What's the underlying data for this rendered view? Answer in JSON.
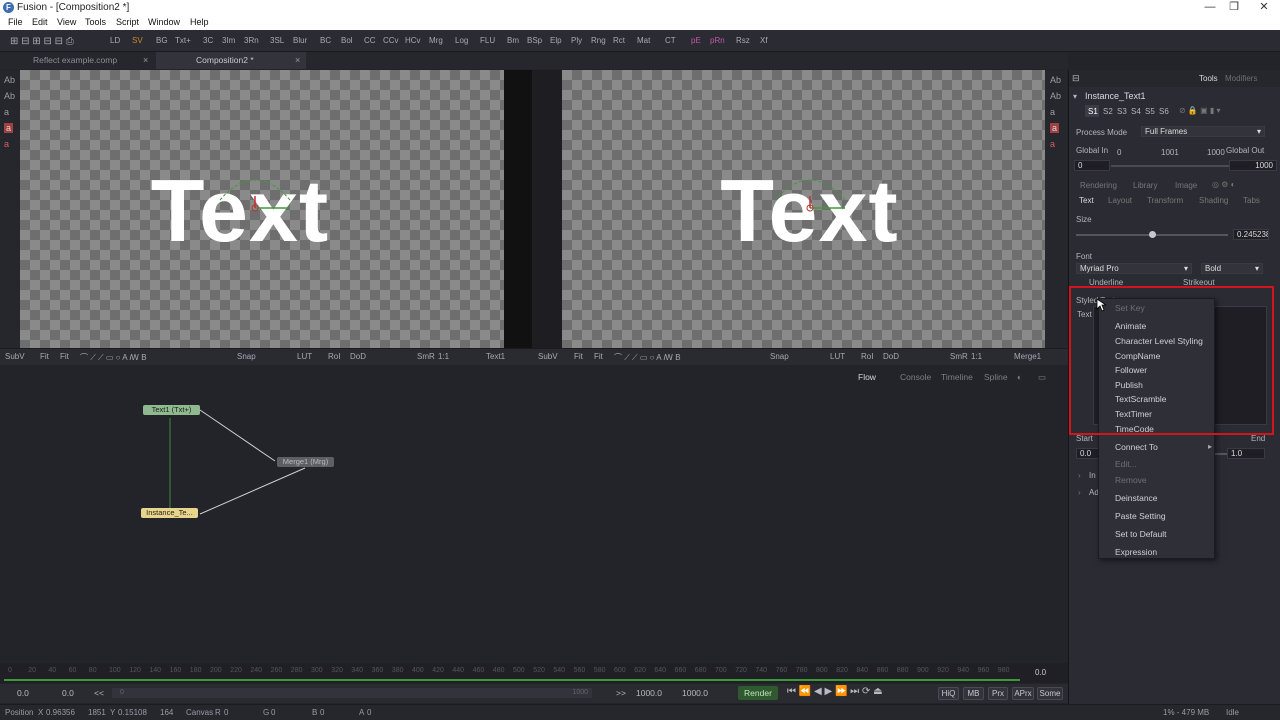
{
  "window": {
    "title": "Fusion - [Composition2 *]",
    "minimize": "—",
    "restore": "❐",
    "close": "✕"
  },
  "menu": [
    "File",
    "Edit",
    "View",
    "Tools",
    "Script",
    "Window",
    "Help"
  ],
  "toolbar": [
    "LD",
    "SV",
    "BG",
    "Txt+",
    "3C",
    "3Im",
    "3Rn",
    "3SL",
    "Blur",
    "BC",
    "Bol",
    "CC",
    "CCv",
    "HCv",
    "Mrg",
    "Log",
    "FLU",
    "Bm",
    "BSp",
    "Elp",
    "Ply",
    "Rng",
    "Rct",
    "Mat",
    "CT",
    "pE",
    "pRn",
    "Rsz",
    "Xf"
  ],
  "tabs": [
    {
      "label": "Reflect example.comp"
    },
    {
      "label": "Composition2 *"
    }
  ],
  "left_strip": [
    "Ab",
    "Ab",
    "a",
    "a",
    "a"
  ],
  "right_strip": [
    "Ab",
    "Ab",
    "a",
    "a",
    "a"
  ],
  "viewer1": {
    "text": "Text",
    "bar": [
      "SubV",
      "Fit",
      "Fit",
      "Snap",
      "LUT",
      "RoI",
      "DoD",
      "SmR",
      "1:1",
      "Text1"
    ]
  },
  "viewer2": {
    "text": "Text",
    "bar": [
      "SubV",
      "Fit",
      "Fit",
      "Snap",
      "LUT",
      "RoI",
      "DoD",
      "SmR",
      "1:1",
      "Merge1"
    ]
  },
  "flow_tabs": [
    "Flow",
    "Console",
    "Timeline",
    "Spline"
  ],
  "nodes": {
    "text1": "Text1 (Txt+)",
    "merge1": "Merge1 (Mrg)",
    "instance": "Instance_Te..."
  },
  "timeline": {
    "ticks": [
      "0",
      "20",
      "40",
      "60",
      "80",
      "100",
      "120",
      "140",
      "160",
      "180",
      "200",
      "220",
      "240",
      "260",
      "280",
      "300",
      "320",
      "340",
      "360",
      "380",
      "400",
      "420",
      "440",
      "460",
      "480",
      "500",
      "520",
      "540",
      "560",
      "580",
      "600",
      "620",
      "640",
      "660",
      "680",
      "700",
      "720",
      "740",
      "760",
      "780",
      "800",
      "820",
      "840",
      "860",
      "880",
      "900",
      "920",
      "940",
      "960",
      "980"
    ],
    "end": "0.0"
  },
  "transport": {
    "start": "0.0",
    "current": "0.0",
    "range_start": "0",
    "range_end": "1000",
    "end1": "1000.0",
    "end2": "1000.0",
    "render": "Render",
    "buttons": [
      "HiQ",
      "MB",
      "Prx",
      "APrx",
      "Some"
    ]
  },
  "status": {
    "position_label": "Position",
    "x_label": "X",
    "x": "0.96356",
    "x_px": "1851",
    "y_label": "Y",
    "y": "0.15108",
    "y_px": "164",
    "canvas_label": "Canvas",
    "r_label": "R",
    "r": "0",
    "g_label": "G",
    "g": "0",
    "b_label": "B",
    "b": "0",
    "a_label": "A",
    "a": "0",
    "memory": "1% - 479 MB",
    "state": "Idle"
  },
  "panel": {
    "tabs": [
      "Tools",
      "Modifiers"
    ],
    "tool_name": "Instance_Text1",
    "slots": [
      "S1",
      "S2",
      "S3",
      "S4",
      "S5",
      "S6"
    ],
    "process_mode_label": "Process Mode",
    "process_mode": "Full Frames",
    "global_in_label": "Global In",
    "global_out_label": "Global Out",
    "gi_min": "0",
    "gi_mid": "1001",
    "gi_max": "1000",
    "gi_val": "0",
    "go_val": "1000",
    "sub_tabs1": [
      "Rendering",
      "Library",
      "Image"
    ],
    "sub_tabs2": [
      "Text",
      "Layout",
      "Transform",
      "Shading",
      "Tabs"
    ],
    "size_label": "Size",
    "size": "0.245238",
    "font_label": "Font",
    "font": "Myriad Pro",
    "style": "Bold",
    "underline": "Underline",
    "strikeout": "Strikeout",
    "styled_text": "Styled Text",
    "text_label": "Text",
    "start_label": "Start",
    "end_label": "End",
    "start_val": "0.0",
    "end_val": "1.0",
    "trunc1": "In",
    "trunc2": "Ad"
  },
  "context_menu": {
    "items": [
      "Set Key",
      "Animate",
      "Character Level Styling",
      "CompName",
      "Follower",
      "Publish",
      "TextScramble",
      "TextTimer",
      "TimeCode",
      "Connect To",
      "Edit...",
      "Remove",
      "Deinstance",
      "Paste Setting",
      "Set to Default",
      "Expression"
    ]
  }
}
